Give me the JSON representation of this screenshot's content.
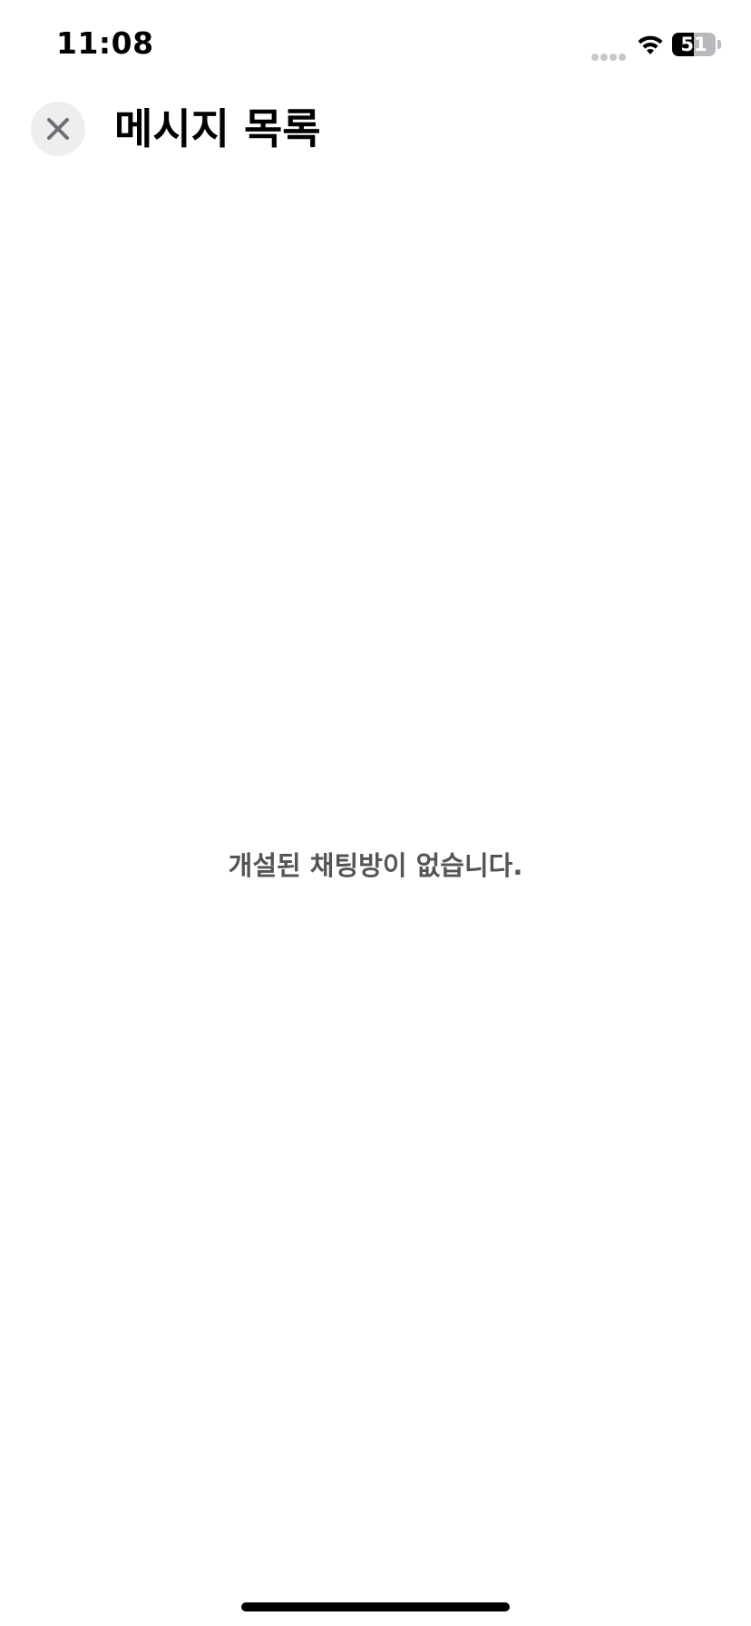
{
  "status_bar": {
    "time": "11:08",
    "battery_level": "51",
    "battery_percent": 51
  },
  "header": {
    "title": "메시지 목록",
    "close_icon": "close-icon"
  },
  "main": {
    "empty_message": "개설된 채팅방이 없습니다."
  },
  "colors": {
    "background": "#ffffff",
    "title": "#000000",
    "empty_text": "#555558",
    "close_bg": "#eeeef0"
  }
}
